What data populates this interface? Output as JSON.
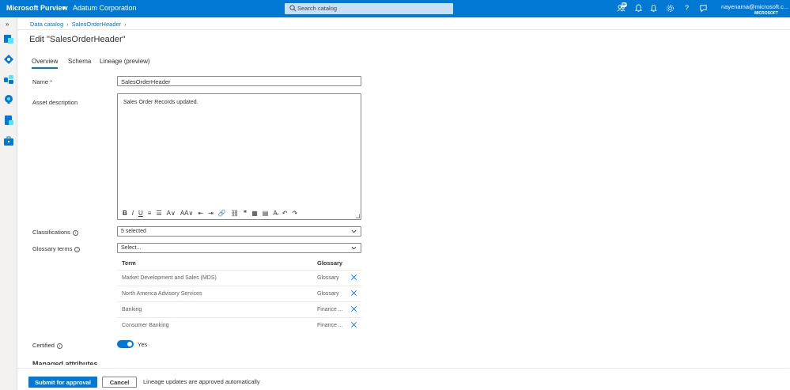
{
  "header": {
    "brand": "Microsoft Purview",
    "org": "Adatum Corporation",
    "search_placeholder": "Search catalog",
    "notification_badge": "99+",
    "user_email": "nayenama@microsoft.c...",
    "user_tenant": "MICROSOFT",
    "icons": [
      "notification-people-icon",
      "bell-icon",
      "gear-icon",
      "help-icon",
      "feedback-icon"
    ]
  },
  "rail": {
    "expand_label": "»",
    "icons": [
      "data-catalog-icon",
      "data-map-icon",
      "data-estate-icon",
      "insights-icon",
      "policy-icon",
      "management-icon"
    ]
  },
  "breadcrumb": [
    "Data catalog",
    "SalesOrderHeader"
  ],
  "page": {
    "title": "Edit \"SalesOrderHeader\""
  },
  "tabs": [
    {
      "label": "Overview",
      "active": true
    },
    {
      "label": "Schema",
      "active": false
    },
    {
      "label": "Lineage (preview)",
      "active": false
    }
  ],
  "form": {
    "name_label": "Name",
    "name_required_mark": "*",
    "name_value": "SalesOrderHeader",
    "description_label": "Asset description",
    "description_value": "Sales Order Records updated.",
    "classifications_label": "Classifications",
    "classifications_value": "5 selected",
    "glossary_label": "Glossary terms",
    "glossary_placeholder": "Select...",
    "glossary_table": {
      "headers": [
        "Term",
        "Glossary"
      ],
      "rows": [
        {
          "term": "Market Development and Sales (MDS)",
          "glossary": "Glossary"
        },
        {
          "term": "North America Advisory Services",
          "glossary": "Glossary"
        },
        {
          "term": "Banking",
          "glossary": "Finance ..."
        },
        {
          "term": "Consumer Banking",
          "glossary": "Finance ..."
        }
      ]
    },
    "certified_label": "Certified",
    "certified_value": "Yes",
    "managed_attributes_label": "Managed attributes"
  },
  "editor_toolbar": [
    "B",
    "I",
    "U",
    "≡",
    "☰",
    "A∨",
    "AA∨",
    "⇤",
    "⇥",
    "🔗",
    "⛓",
    "❞",
    "▦",
    "▤",
    "A̶",
    "↶",
    "↷"
  ],
  "footer": {
    "submit_label": "Submit for approval",
    "cancel_label": "Cancel",
    "note": "Lineage updates are approved automatically"
  },
  "colors": {
    "accent": "#0078d4",
    "topbar": "#0078d4",
    "rail": "#f3f2f1"
  }
}
